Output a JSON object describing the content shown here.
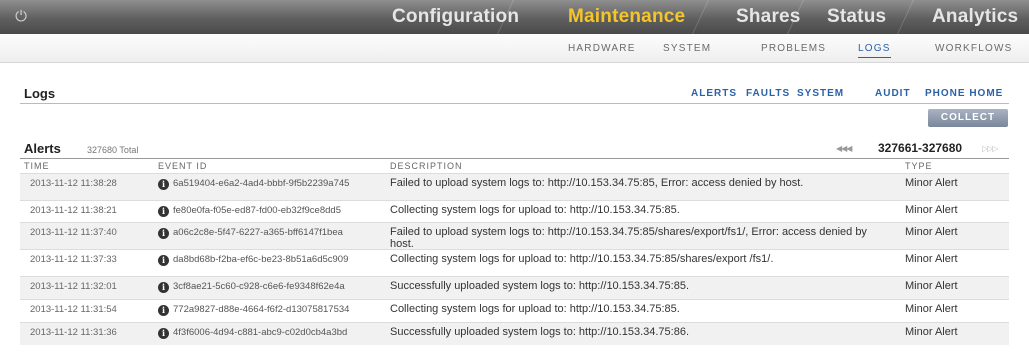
{
  "nav": {
    "tabs": [
      {
        "label": "Configuration",
        "active": false
      },
      {
        "label": "Maintenance",
        "active": true
      },
      {
        "label": "Shares",
        "active": false
      },
      {
        "label": "Status",
        "active": false
      },
      {
        "label": "Analytics",
        "active": false
      }
    ],
    "power_icon": "power-icon",
    "active_color": "#f5c62a"
  },
  "subnav": {
    "items": [
      {
        "label": "HARDWARE",
        "active": false
      },
      {
        "label": "SYSTEM",
        "active": false
      },
      {
        "label": "PROBLEMS",
        "active": false
      },
      {
        "label": "LOGS",
        "active": true
      },
      {
        "label": "WORKFLOWS",
        "active": false
      }
    ]
  },
  "logs": {
    "title": "Logs",
    "types": [
      "ALERTS",
      "FAULTS",
      "SYSTEM",
      "AUDIT",
      "PHONE HOME"
    ],
    "collect_label": "COLLECT"
  },
  "alerts": {
    "title": "Alerts",
    "total": "327680 Total",
    "range": "327661-327680",
    "columns": [
      "TIME",
      "EVENT ID",
      "DESCRIPTION",
      "TYPE"
    ],
    "rows": [
      {
        "time": "2013-11-12 11:38:28",
        "event_id": "6a519404-e6a2-4ad4-bbbf-9f5b2239a745",
        "description": "Failed to upload system logs to: http://10.153.34.75:85, Error: access denied by host.",
        "type": "Minor Alert"
      },
      {
        "time": "2013-11-12 11:38:21",
        "event_id": "fe80e0fa-f05e-ed87-fd00-eb32f9ce8dd5",
        "description": "Collecting system logs for upload to: http://10.153.34.75:85.",
        "type": "Minor Alert"
      },
      {
        "time": "2013-11-12 11:37:40",
        "event_id": "a06c2c8e-5f47-6227-a365-bff6147f1bea",
        "description": "Failed to upload system logs to: http://10.153.34.75:85/shares/export/fs1/, Error: access denied by host.",
        "type": "Minor Alert"
      },
      {
        "time": "2013-11-12 11:37:33",
        "event_id": "da8bd68b-f2ba-ef6c-be23-8b51a6d5c909",
        "description": "Collecting system logs for upload to: http://10.153.34.75:85/shares/export /fs1/.",
        "type": "Minor Alert"
      },
      {
        "time": "2013-11-12 11:32:01",
        "event_id": "3cf8ae21-5c60-c928-c6e6-fe9348f62e4a",
        "description": "Successfully uploaded system logs to: http://10.153.34.75:85.",
        "type": "Minor Alert"
      },
      {
        "time": "2013-11-12 11:31:54",
        "event_id": "772a9827-d88e-4664-f6f2-d13075817534",
        "description": "Collecting system logs for upload to: http://10.153.34.75:85.",
        "type": "Minor Alert"
      },
      {
        "time": "2013-11-12 11:31:36",
        "event_id": "4f3f6006-4d94-c881-abc9-c02d0cb4a3bd",
        "description": "Successfully uploaded system logs to: http://10.153.34.75:86.",
        "type": "Minor Alert"
      }
    ]
  }
}
